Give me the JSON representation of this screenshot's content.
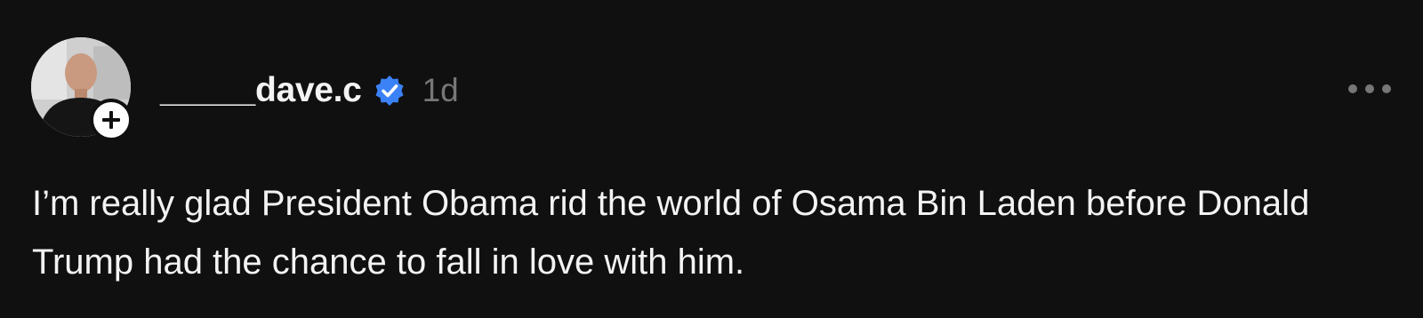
{
  "post": {
    "author": {
      "username": "_____dave.c",
      "verified": true,
      "avatar_icon": "profile-photo",
      "follow_icon": "plus-icon"
    },
    "timestamp": "1d",
    "more_icon": "more-horizontal-icon",
    "text": "I’m really glad President Obama rid the world of Osama Bin Laden before Donald Trump had the chance to fall in love with him."
  },
  "colors": {
    "background": "#101010",
    "text": "#f3f3f3",
    "muted": "#777777",
    "verified": "#3b82f6"
  }
}
